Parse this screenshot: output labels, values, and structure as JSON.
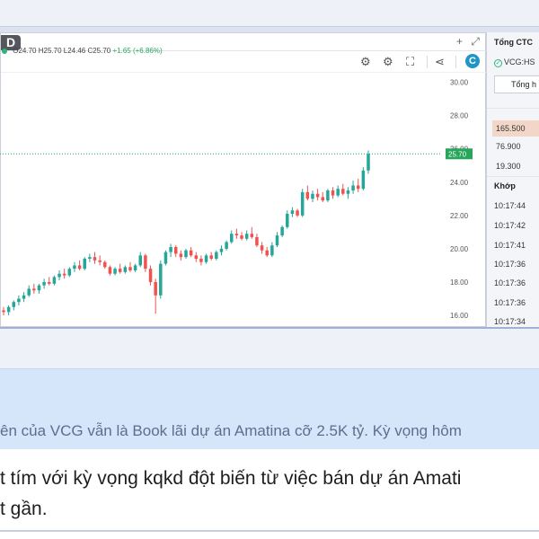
{
  "chart_panel": {
    "badge": "D",
    "title_icons": [
      "plus-icon",
      "expand-icon"
    ],
    "toolbar": [
      "settings-gear-icon",
      "gear-icon",
      "fullscreen-icon",
      "share-icon",
      "c-logo-icon"
    ],
    "ohlc": {
      "open": "O24.70",
      "high": "H25.70",
      "low": "L24.46",
      "close": "C25.70",
      "change": "+1.65 (+6.86%)"
    },
    "last_price_label": "25.70"
  },
  "chart_data": {
    "type": "candlestick",
    "y_ticks": [
      "30.00",
      "28.00",
      "26.00",
      "24.00",
      "22.00",
      "20.00",
      "18.00",
      "16.00"
    ],
    "ylim": [
      15.3,
      30.3
    ],
    "last_price": 25.7,
    "colors": {
      "up": "#26a69a",
      "down": "#ef5350",
      "last_price_tag": "#26a65b"
    },
    "candles": [
      [
        16.3,
        16.5,
        16.0,
        16.2
      ],
      [
        16.2,
        16.6,
        16.0,
        16.5
      ],
      [
        16.5,
        16.9,
        16.3,
        16.8
      ],
      [
        16.8,
        17.2,
        16.6,
        17.0
      ],
      [
        17.0,
        17.4,
        16.8,
        17.2
      ],
      [
        17.2,
        17.8,
        17.1,
        17.6
      ],
      [
        17.6,
        17.9,
        17.3,
        17.5
      ],
      [
        17.5,
        17.9,
        17.3,
        17.8
      ],
      [
        17.8,
        18.2,
        17.6,
        18.0
      ],
      [
        18.0,
        18.3,
        17.8,
        17.9
      ],
      [
        17.9,
        18.4,
        17.8,
        18.3
      ],
      [
        18.3,
        18.7,
        18.1,
        18.5
      ],
      [
        18.5,
        18.8,
        18.2,
        18.4
      ],
      [
        18.4,
        18.9,
        18.3,
        18.8
      ],
      [
        18.8,
        19.2,
        18.6,
        19.0
      ],
      [
        19.0,
        19.3,
        18.7,
        18.8
      ],
      [
        18.8,
        19.5,
        18.7,
        19.4
      ],
      [
        19.4,
        19.7,
        19.2,
        19.5
      ],
      [
        19.5,
        19.8,
        19.1,
        19.3
      ],
      [
        19.3,
        19.6,
        19.0,
        19.2
      ],
      [
        19.2,
        19.3,
        18.8,
        18.9
      ],
      [
        18.9,
        19.0,
        18.4,
        18.5
      ],
      [
        18.5,
        18.9,
        18.4,
        18.8
      ],
      [
        18.8,
        19.1,
        18.5,
        18.6
      ],
      [
        18.6,
        19.0,
        18.5,
        18.9
      ],
      [
        18.9,
        19.2,
        18.6,
        18.7
      ],
      [
        18.7,
        19.1,
        18.6,
        19.0
      ],
      [
        19.0,
        19.8,
        18.9,
        19.6
      ],
      [
        19.6,
        19.7,
        18.6,
        18.8
      ],
      [
        18.8,
        19.0,
        17.8,
        18.0
      ],
      [
        18.0,
        18.2,
        16.1,
        17.2
      ],
      [
        17.2,
        19.3,
        17.0,
        19.1
      ],
      [
        19.1,
        19.9,
        19.0,
        19.8
      ],
      [
        19.8,
        20.3,
        19.5,
        20.1
      ],
      [
        20.1,
        20.2,
        19.5,
        19.7
      ],
      [
        19.7,
        19.9,
        19.3,
        19.5
      ],
      [
        19.5,
        20.0,
        19.4,
        19.9
      ],
      [
        19.9,
        20.1,
        19.5,
        19.6
      ],
      [
        19.6,
        19.8,
        19.2,
        19.4
      ],
      [
        19.4,
        19.6,
        19.0,
        19.2
      ],
      [
        19.2,
        19.7,
        19.1,
        19.6
      ],
      [
        19.6,
        19.8,
        19.3,
        19.4
      ],
      [
        19.4,
        19.9,
        19.3,
        19.8
      ],
      [
        19.8,
        20.2,
        19.6,
        20.0
      ],
      [
        20.0,
        20.5,
        19.9,
        20.4
      ],
      [
        20.4,
        21.1,
        20.3,
        20.9
      ],
      [
        20.9,
        21.2,
        20.6,
        20.8
      ],
      [
        20.8,
        21.0,
        20.5,
        20.6
      ],
      [
        20.6,
        21.1,
        20.5,
        20.9
      ],
      [
        20.9,
        21.3,
        20.6,
        20.7
      ],
      [
        20.7,
        20.9,
        20.1,
        20.2
      ],
      [
        20.2,
        20.4,
        19.7,
        19.9
      ],
      [
        19.9,
        20.1,
        19.5,
        19.6
      ],
      [
        19.6,
        20.4,
        19.5,
        20.2
      ],
      [
        20.2,
        21.0,
        20.1,
        20.8
      ],
      [
        20.8,
        21.4,
        20.7,
        21.3
      ],
      [
        21.3,
        22.3,
        21.2,
        22.1
      ],
      [
        22.1,
        22.5,
        21.9,
        22.3
      ],
      [
        22.3,
        22.4,
        21.9,
        22.0
      ],
      [
        22.0,
        23.6,
        21.9,
        23.4
      ],
      [
        23.4,
        23.8,
        22.9,
        23.0
      ],
      [
        23.0,
        23.5,
        22.8,
        23.3
      ],
      [
        23.3,
        23.6,
        22.9,
        23.1
      ],
      [
        23.1,
        23.4,
        22.8,
        22.9
      ],
      [
        22.9,
        23.6,
        22.8,
        23.5
      ],
      [
        23.5,
        23.7,
        23.0,
        23.2
      ],
      [
        23.2,
        23.8,
        23.1,
        23.6
      ],
      [
        23.6,
        23.9,
        23.2,
        23.3
      ],
      [
        23.3,
        23.7,
        23.0,
        23.5
      ],
      [
        23.5,
        24.1,
        23.3,
        23.8
      ],
      [
        23.8,
        24.2,
        23.4,
        23.6
      ],
      [
        23.6,
        24.9,
        23.5,
        24.7
      ],
      [
        24.7,
        25.9,
        24.5,
        25.7
      ]
    ]
  },
  "right_panel": {
    "title": "Tổng CTC",
    "symbol": "VCG:HS",
    "tab_label": "Tổng h",
    "prices": [
      "165.500",
      "76.900",
      "19.300"
    ],
    "khop_label": "Khớp",
    "times": [
      "10:17:44",
      "10:17:42",
      "10:17:41",
      "10:17:36",
      "10:17:36",
      "10:17:36",
      "10:17:34"
    ]
  },
  "post": {
    "quote_line": "ên của VCG vẫn là Book lãi dự án Amatina cỡ 2.5K tỷ. Kỳ vọng hôm",
    "body_line_1": "t tím với kỳ vọng kqkd đột biến từ việc bán dự án Amati",
    "body_line_2": "t gần."
  }
}
